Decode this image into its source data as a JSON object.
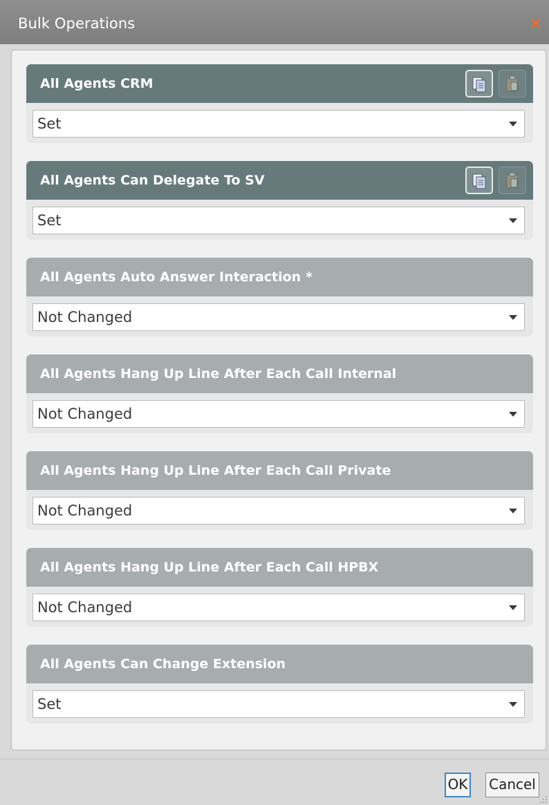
{
  "window": {
    "title": "Bulk Operations",
    "close_glyph": "×"
  },
  "colors": {
    "active_header": "#667a7b",
    "inactive_header": "#a7acac",
    "close_accent": "#ff6a1a",
    "ok_focus": "#3d83c9"
  },
  "groups": [
    {
      "label": "All Agents CRM",
      "value": "Set",
      "active": true,
      "icons": [
        "copy-icon",
        "paste-icon"
      ]
    },
    {
      "label": "All Agents Can Delegate To SV",
      "value": "Set",
      "active": true,
      "icons": [
        "copy-icon",
        "paste-icon"
      ]
    },
    {
      "label": "All Agents Auto Answer Interaction *",
      "value": "Not Changed",
      "active": false
    },
    {
      "label": "All Agents Hang Up Line After Each Call Internal",
      "value": "Not Changed",
      "active": false
    },
    {
      "label": "All Agents Hang Up Line After Each Call Private",
      "value": "Not Changed",
      "active": false
    },
    {
      "label": "All Agents Hang Up Line After Each Call HPBX",
      "value": "Not Changed",
      "active": false
    },
    {
      "label": "All Agents Can Change Extension",
      "value": "Set",
      "active": false
    }
  ],
  "footer": {
    "ok_label": "OK",
    "cancel_label": "Cancel"
  }
}
